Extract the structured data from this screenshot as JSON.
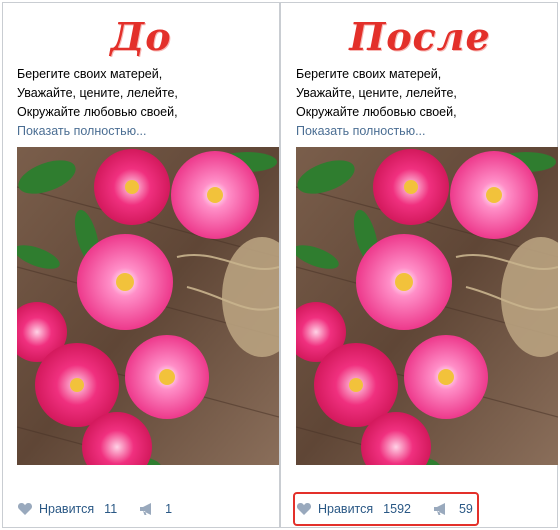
{
  "before": {
    "heading": "До",
    "text_lines": [
      "Берегите своих матерей,",
      "Уважайте, цените, лелейте,",
      "Окружайте любовью своей,"
    ],
    "show_more": "Показать полностью...",
    "like_label": "Нравится",
    "like_count": "11",
    "share_count": "1"
  },
  "after": {
    "heading": "После",
    "text_lines": [
      "Берегите своих матерей,",
      "Уважайте, цените, лелейте,",
      "Окружайте любовью своей,"
    ],
    "show_more": "Показать полностью...",
    "like_label": "Нравится",
    "like_count": "1592",
    "share_count": "59"
  },
  "colors": {
    "heading": "#e3302a",
    "link": "#4b6e93",
    "highlight": "#e3302a",
    "icon": "#99a9bd"
  },
  "icons": {
    "like": "heart-icon",
    "share": "megaphone-icon"
  }
}
